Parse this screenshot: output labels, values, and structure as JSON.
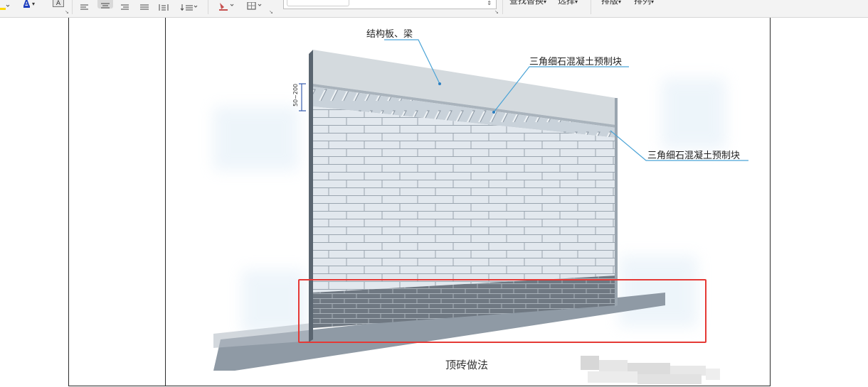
{
  "toolbar": {
    "font_color_label": "A",
    "char_shading_label": "A",
    "find_replace_label": "查找替换",
    "select_label": "选择",
    "layout_label": "排版",
    "arrange_label": "排列",
    "style_box_value": ""
  },
  "figure": {
    "label_slab": "结构板、梁",
    "label_block_top": "三角细石混凝土预制块",
    "label_block_right": "三角细石混凝土预制块",
    "dimension": "50~200",
    "caption": "顶砖做法"
  },
  "colors": {
    "highlight": "#e53935",
    "leader_line": "#4aa3d6",
    "wall": "#dfe6ec",
    "slab": "#d3d9de",
    "base_bricks": "#6e7780"
  }
}
